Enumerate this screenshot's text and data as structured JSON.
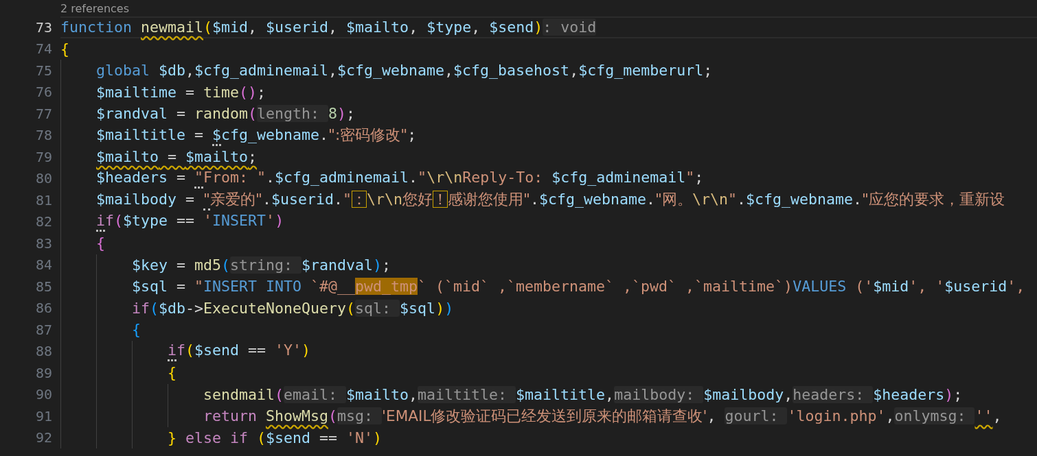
{
  "codelens": "2 references",
  "lines": [
    {
      "number": "73",
      "current": true,
      "tokens": [
        {
          "kind": "keyword",
          "text": "function "
        },
        {
          "kind": "function",
          "text": "newmail",
          "squiggle": true
        },
        {
          "kind": "bracket1",
          "text": "("
        },
        {
          "kind": "variable",
          "text": "$mid"
        },
        {
          "kind": "plain",
          "text": ", "
        },
        {
          "kind": "variable",
          "text": "$userid"
        },
        {
          "kind": "plain",
          "text": ", "
        },
        {
          "kind": "variable",
          "text": "$mailto"
        },
        {
          "kind": "plain",
          "text": ", "
        },
        {
          "kind": "variable",
          "text": "$type"
        },
        {
          "kind": "plain",
          "text": ", "
        },
        {
          "kind": "variable",
          "text": "$send"
        },
        {
          "kind": "bracket1",
          "text": ")"
        },
        {
          "kind": "hint",
          "text": ": void"
        }
      ]
    },
    {
      "number": "74",
      "current": false,
      "tokens": [
        {
          "kind": "bracket1",
          "text": "{"
        }
      ]
    },
    {
      "number": "75",
      "current": false,
      "tokens": [
        {
          "kind": "keyword",
          "text": "    global "
        },
        {
          "kind": "variable",
          "text": "$db"
        },
        {
          "kind": "plain",
          "text": ","
        },
        {
          "kind": "variable",
          "text": "$cfg_adminemail"
        },
        {
          "kind": "plain",
          "text": ","
        },
        {
          "kind": "variable",
          "text": "$cfg_webname"
        },
        {
          "kind": "plain",
          "text": ","
        },
        {
          "kind": "variable",
          "text": "$cfg_basehost"
        },
        {
          "kind": "plain",
          "text": ","
        },
        {
          "kind": "variable",
          "text": "$cfg_memberurl"
        },
        {
          "kind": "plain",
          "text": ";"
        }
      ]
    },
    {
      "number": "76",
      "current": false,
      "tokens": [
        {
          "kind": "variable",
          "text": "    $mailtime"
        },
        {
          "kind": "plain",
          "text": " = "
        },
        {
          "kind": "function",
          "text": "time"
        },
        {
          "kind": "bracket2",
          "text": "()"
        },
        {
          "kind": "plain",
          "text": ";"
        }
      ]
    },
    {
      "number": "77",
      "current": false,
      "tokens": [
        {
          "kind": "variable",
          "text": "    $randval"
        },
        {
          "kind": "plain",
          "text": " = "
        },
        {
          "kind": "function",
          "text": "random"
        },
        {
          "kind": "bracket2",
          "text": "("
        },
        {
          "kind": "hint",
          "text": "length: "
        },
        {
          "kind": "number",
          "text": "8"
        },
        {
          "kind": "bracket2",
          "text": ")"
        },
        {
          "kind": "plain",
          "text": ";"
        }
      ]
    },
    {
      "number": "78",
      "current": false,
      "tokens": [
        {
          "kind": "variable",
          "text": "    $mailtitle"
        },
        {
          "kind": "plain",
          "text": " = "
        },
        {
          "kind": "variable",
          "text": "$cfg_webname",
          "dotted": true
        },
        {
          "kind": "plain",
          "text": "."
        },
        {
          "kind": "string",
          "text": "\":密码修改\""
        },
        {
          "kind": "plain",
          "text": ";"
        }
      ]
    },
    {
      "number": "79",
      "current": false,
      "tokens": [
        {
          "kind": "variable",
          "text": "    $mailto",
          "squiggle": true
        },
        {
          "kind": "plain",
          "text": " = ",
          "squiggle": true
        },
        {
          "kind": "variable",
          "text": "$mailto",
          "squiggle": true
        },
        {
          "kind": "plain",
          "text": ";",
          "squiggle": true
        }
      ]
    },
    {
      "number": "80",
      "current": false,
      "tokens": [
        {
          "kind": "variable",
          "text": "    $headers"
        },
        {
          "kind": "plain",
          "text": " = "
        },
        {
          "kind": "string",
          "text": "\"From: \"",
          "dotted": true
        },
        {
          "kind": "plain",
          "text": "."
        },
        {
          "kind": "variable",
          "text": "$cfg_adminemail"
        },
        {
          "kind": "plain",
          "text": "."
        },
        {
          "kind": "string",
          "text": "\""
        },
        {
          "kind": "escape",
          "text": "\\r\\n"
        },
        {
          "kind": "string",
          "text": "Reply-To: "
        },
        {
          "kind": "variable",
          "text": "$cfg_adminemail"
        },
        {
          "kind": "string",
          "text": "\""
        },
        {
          "kind": "plain",
          "text": ";"
        }
      ]
    },
    {
      "number": "81",
      "current": false,
      "tokens": [
        {
          "kind": "variable",
          "text": "    $mailbody"
        },
        {
          "kind": "plain",
          "text": " = "
        },
        {
          "kind": "string",
          "text": "\"亲爱的\"",
          "dotted": true
        },
        {
          "kind": "plain",
          "text": "."
        },
        {
          "kind": "variable",
          "text": "$userid"
        },
        {
          "kind": "plain",
          "text": "."
        },
        {
          "kind": "string",
          "text": "\""
        },
        {
          "kind": "string",
          "text": "：",
          "boxed": true
        },
        {
          "kind": "escape",
          "text": "\\r\\n"
        },
        {
          "kind": "string",
          "text": "您好"
        },
        {
          "kind": "string",
          "text": "！",
          "boxed": true
        },
        {
          "kind": "string",
          "text": "感谢您使用\""
        },
        {
          "kind": "plain",
          "text": "."
        },
        {
          "kind": "variable",
          "text": "$cfg_webname"
        },
        {
          "kind": "plain",
          "text": "."
        },
        {
          "kind": "string",
          "text": "\"网。"
        },
        {
          "kind": "escape",
          "text": "\\r\\n"
        },
        {
          "kind": "string",
          "text": "\""
        },
        {
          "kind": "plain",
          "text": "."
        },
        {
          "kind": "variable",
          "text": "$cfg_webname"
        },
        {
          "kind": "plain",
          "text": "."
        },
        {
          "kind": "string",
          "text": "\"应您的要求，重新设"
        }
      ]
    },
    {
      "number": "82",
      "current": false,
      "tokens": [
        {
          "kind": "control",
          "text": "    if",
          "dotted": true
        },
        {
          "kind": "bracket2",
          "text": "("
        },
        {
          "kind": "variable",
          "text": "$type"
        },
        {
          "kind": "plain",
          "text": " == "
        },
        {
          "kind": "string",
          "text": "'"
        },
        {
          "kind": "keyword",
          "text": "INSERT"
        },
        {
          "kind": "string",
          "text": "'"
        },
        {
          "kind": "bracket2",
          "text": ")"
        }
      ]
    },
    {
      "number": "83",
      "current": false,
      "tokens": [
        {
          "kind": "bracket2",
          "text": "    {"
        }
      ]
    },
    {
      "number": "84",
      "current": false,
      "tokens": [
        {
          "kind": "variable",
          "text": "        $key"
        },
        {
          "kind": "plain",
          "text": " = "
        },
        {
          "kind": "function",
          "text": "md5"
        },
        {
          "kind": "bracket3",
          "text": "("
        },
        {
          "kind": "hint",
          "text": "string: "
        },
        {
          "kind": "variable",
          "text": "$randval"
        },
        {
          "kind": "bracket3",
          "text": ")"
        },
        {
          "kind": "plain",
          "text": ";"
        }
      ]
    },
    {
      "number": "85",
      "current": false,
      "tokens": [
        {
          "kind": "variable",
          "text": "        $sql"
        },
        {
          "kind": "plain",
          "text": " = "
        },
        {
          "kind": "string",
          "text": "\""
        },
        {
          "kind": "keyword",
          "text": "INSERT INTO"
        },
        {
          "kind": "string",
          "text": " `#@__"
        },
        {
          "kind": "string",
          "text": "pwd_tmp",
          "match": true
        },
        {
          "kind": "string",
          "text": "` (`mid` ,`membername` ,`pwd` ,`mailtime`)"
        },
        {
          "kind": "keyword",
          "text": "VALUES"
        },
        {
          "kind": "string",
          "text": " ('"
        },
        {
          "kind": "variable",
          "text": "$mid"
        },
        {
          "kind": "string",
          "text": "', '"
        },
        {
          "kind": "variable",
          "text": "$userid"
        },
        {
          "kind": "string",
          "text": "',"
        }
      ]
    },
    {
      "number": "86",
      "current": false,
      "tokens": [
        {
          "kind": "control",
          "text": "        if"
        },
        {
          "kind": "bracket3",
          "text": "("
        },
        {
          "kind": "variable",
          "text": "$db"
        },
        {
          "kind": "plain",
          "text": "->"
        },
        {
          "kind": "function",
          "text": "ExecuteNoneQuery"
        },
        {
          "kind": "bracket1",
          "text": "("
        },
        {
          "kind": "hint",
          "text": "sql: "
        },
        {
          "kind": "variable",
          "text": "$sql"
        },
        {
          "kind": "bracket1",
          "text": ")"
        },
        {
          "kind": "bracket3",
          "text": ")"
        }
      ]
    },
    {
      "number": "87",
      "current": false,
      "tokens": [
        {
          "kind": "bracket3",
          "text": "        {"
        }
      ]
    },
    {
      "number": "88",
      "current": false,
      "tokens": [
        {
          "kind": "control",
          "text": "            if",
          "dotted": true
        },
        {
          "kind": "bracket1",
          "text": "("
        },
        {
          "kind": "variable",
          "text": "$send"
        },
        {
          "kind": "plain",
          "text": " == "
        },
        {
          "kind": "string",
          "text": "'Y'"
        },
        {
          "kind": "bracket1",
          "text": ")"
        }
      ]
    },
    {
      "number": "89",
      "current": false,
      "tokens": [
        {
          "kind": "bracket1",
          "text": "            {"
        }
      ]
    },
    {
      "number": "90",
      "current": false,
      "tokens": [
        {
          "kind": "function",
          "text": "                sendmail"
        },
        {
          "kind": "bracket2",
          "text": "("
        },
        {
          "kind": "hint",
          "text": "email: "
        },
        {
          "kind": "variable",
          "text": "$mailto"
        },
        {
          "kind": "plain",
          "text": ","
        },
        {
          "kind": "hint",
          "text": "mailtitle: "
        },
        {
          "kind": "variable",
          "text": "$mailtitle"
        },
        {
          "kind": "plain",
          "text": ","
        },
        {
          "kind": "hint",
          "text": "mailbody: "
        },
        {
          "kind": "variable",
          "text": "$mailbody"
        },
        {
          "kind": "plain",
          "text": ","
        },
        {
          "kind": "hint",
          "text": "headers: "
        },
        {
          "kind": "variable",
          "text": "$headers"
        },
        {
          "kind": "bracket2",
          "text": ")"
        },
        {
          "kind": "plain",
          "text": ";"
        }
      ]
    },
    {
      "number": "91",
      "current": false,
      "tokens": [
        {
          "kind": "control",
          "text": "                return "
        },
        {
          "kind": "function",
          "text": "ShowMsg",
          "squiggle": true
        },
        {
          "kind": "bracket2",
          "text": "("
        },
        {
          "kind": "hint",
          "text": "msg: "
        },
        {
          "kind": "string",
          "text": "'EMAIL修改验证码已经发送到原来的邮箱请查收'"
        },
        {
          "kind": "plain",
          "text": ", "
        },
        {
          "kind": "hint",
          "text": "gourl: "
        },
        {
          "kind": "string",
          "text": "'login.php'"
        },
        {
          "kind": "plain",
          "text": ","
        },
        {
          "kind": "hint",
          "text": "onlymsg: "
        },
        {
          "kind": "string",
          "text": "''",
          "squiggle": true
        },
        {
          "kind": "plain",
          "text": ","
        }
      ]
    },
    {
      "number": "92",
      "current": false,
      "tokens": [
        {
          "kind": "bracket1",
          "text": "            } "
        },
        {
          "kind": "control",
          "text": "else "
        },
        {
          "kind": "control",
          "text": "if "
        },
        {
          "kind": "bracket1",
          "text": "("
        },
        {
          "kind": "variable",
          "text": "$send"
        },
        {
          "kind": "plain",
          "text": " == "
        },
        {
          "kind": "string",
          "text": "'N'"
        },
        {
          "kind": "bracket1",
          "text": ")"
        }
      ]
    }
  ]
}
